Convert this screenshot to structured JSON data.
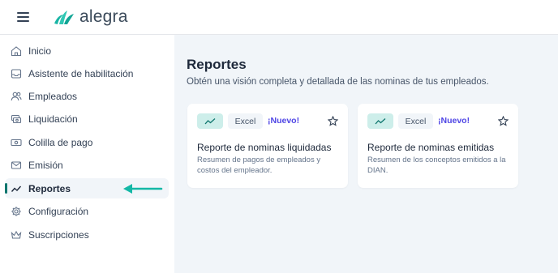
{
  "app": {
    "name": "alegra"
  },
  "sidebar": {
    "items": [
      {
        "label": "Inicio",
        "icon": "home-icon"
      },
      {
        "label": "Asistente de habilitación",
        "icon": "inbox-icon"
      },
      {
        "label": "Empleados",
        "icon": "users-icon"
      },
      {
        "label": "Liquidación",
        "icon": "coins-icon"
      },
      {
        "label": "Colilla de pago",
        "icon": "cash-icon"
      },
      {
        "label": "Emisión",
        "icon": "mail-icon"
      },
      {
        "label": "Reportes",
        "icon": "trend-icon",
        "active": true
      },
      {
        "label": "Configuración",
        "icon": "gear-icon"
      },
      {
        "label": "Suscripciones",
        "icon": "crown-icon"
      }
    ]
  },
  "main": {
    "title": "Reportes",
    "subtitle": "Obtén una visión completa y detallada de las nominas de tus empleados.",
    "cards": [
      {
        "excel_label": "Excel",
        "badge": "¡Nuevo!",
        "title": "Reporte de nominas liquidadas",
        "description": "Resumen de pagos de empleados y costos del empleador."
      },
      {
        "excel_label": "Excel",
        "badge": "¡Nuevo!",
        "title": "Reporte de nominas emitidas",
        "description": "Resumen de los conceptos emitidos a la DIAN."
      }
    ]
  },
  "colors": {
    "accent": "#0f766e",
    "chip": "#cdeeea",
    "badge": "#4f46e5",
    "arrow": "#14b8a6"
  }
}
